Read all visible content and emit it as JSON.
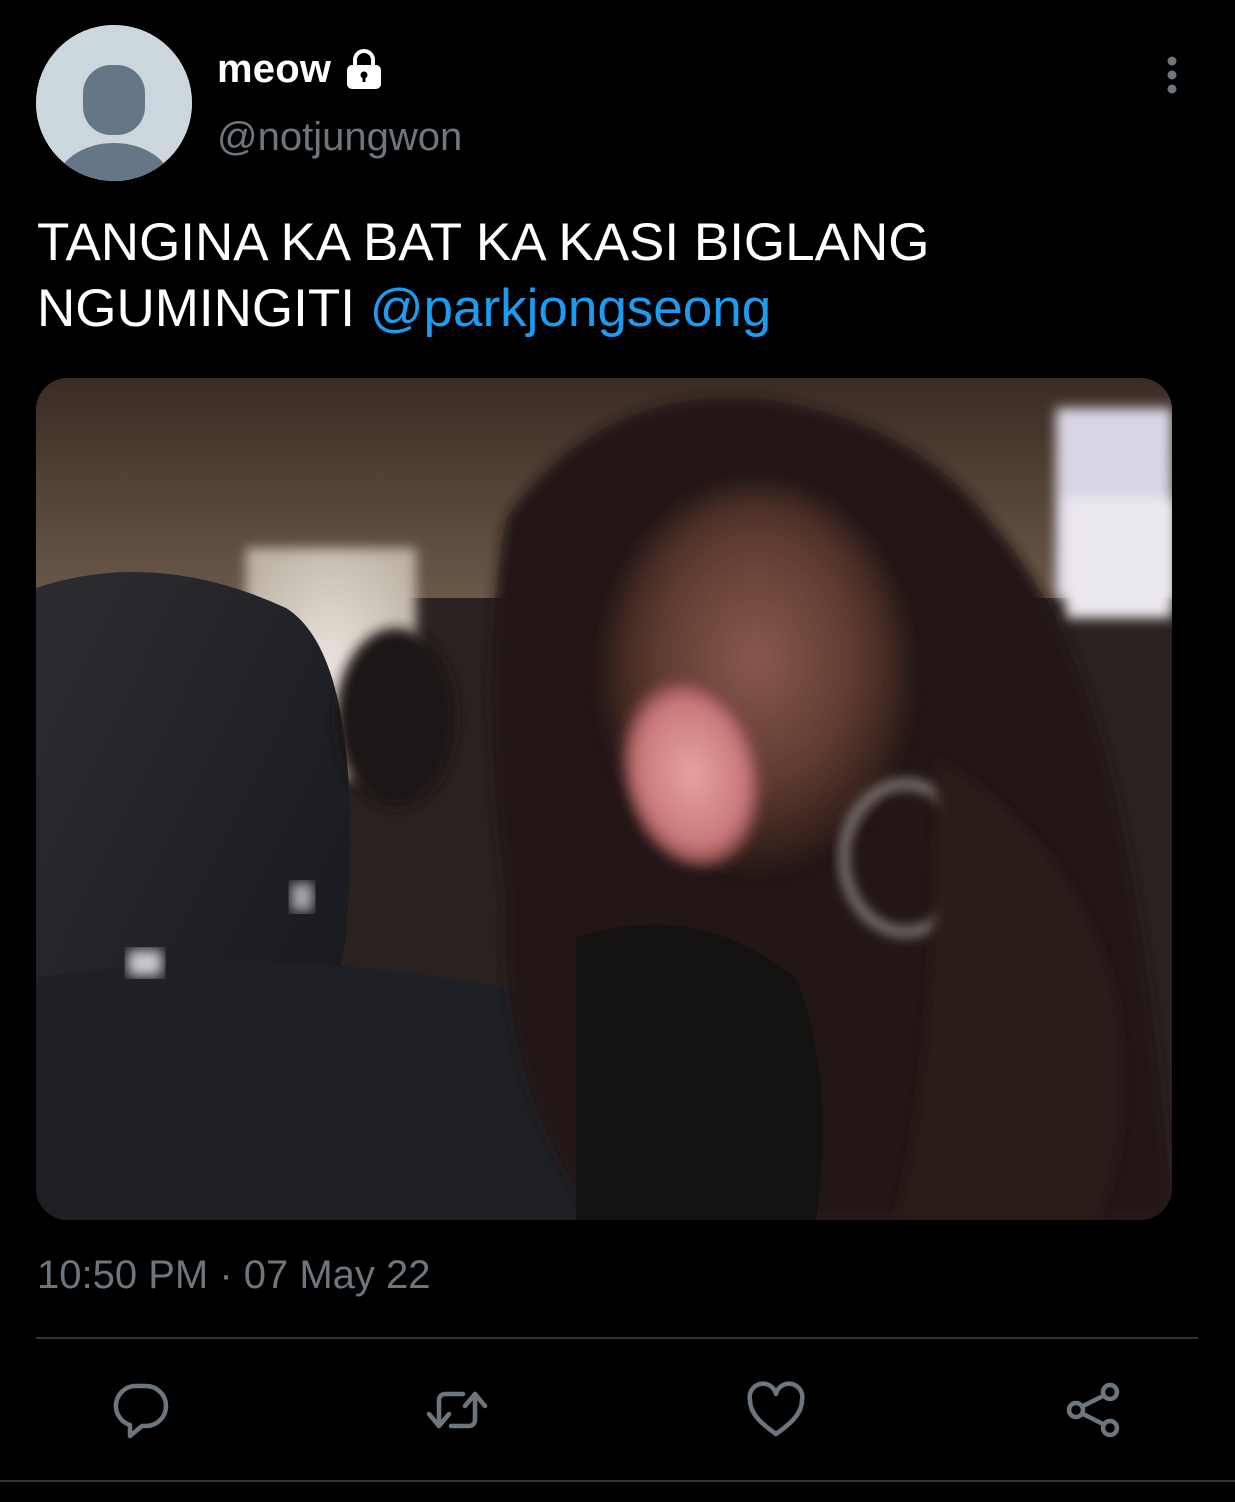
{
  "tweet": {
    "author": {
      "display_name": "meow",
      "handle": "@notjungwon",
      "protected": true,
      "avatar_icon": "default-avatar-icon",
      "lock_icon": "lock-icon"
    },
    "text": {
      "body": "TANGINA KA BAT KA KASI BIGLANG NGUMINGITI ",
      "mention": "@parkjongseong"
    },
    "media": {
      "type": "photo"
    },
    "timestamp": "10:50 PM · 07 May 22",
    "actions": [
      {
        "name": "reply",
        "icon": "reply-icon"
      },
      {
        "name": "retweet",
        "icon": "retweet-icon"
      },
      {
        "name": "like",
        "icon": "heart-icon"
      },
      {
        "name": "share",
        "icon": "share-icon"
      }
    ],
    "more_icon": "more-vertical-icon"
  },
  "colors": {
    "background": "#000000",
    "text_primary": "#ffffff",
    "text_secondary": "#6e767d",
    "link": "#1d9bf0",
    "divider": "#2f3336",
    "avatar_bg": "#ccd6dd",
    "avatar_silhouette": "#657786"
  }
}
